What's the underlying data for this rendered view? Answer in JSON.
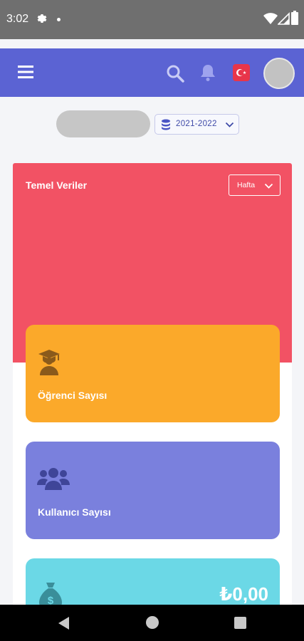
{
  "status_bar": {
    "time": "3:02"
  },
  "app_bar": {
    "icons": [
      "menu-icon",
      "search-icon",
      "bell-icon",
      "turkey-flag-icon",
      "avatar"
    ],
    "accent": "#5b63d3"
  },
  "filters": {
    "school_year": "2021-2022"
  },
  "main_card": {
    "title": "Temel Veriler",
    "period_button": "Hafta",
    "header_color": "#f25264"
  },
  "stats": [
    {
      "label": "Öğrenci Sayısı",
      "icon": "graduate-icon",
      "color": "#fba92a"
    },
    {
      "label": "Kullanıcı Sayısı",
      "icon": "users-group-icon",
      "color": "#7a80dd"
    },
    {
      "value": "₺0,00",
      "icon": "money-bag-icon",
      "color": "#6bd8e6"
    }
  ]
}
